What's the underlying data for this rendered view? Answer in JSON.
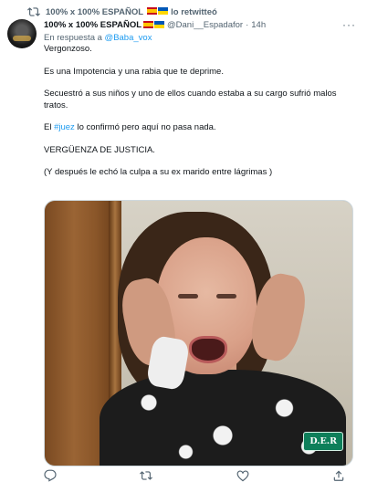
{
  "retweet_bar": {
    "retweeter_name": "100% x 100% ESPAÑOL",
    "retweet_label": "lo retwitteó"
  },
  "tweet": {
    "author_name": "100% x 100% ESPAÑOL",
    "handle": "@Dani__Espadafor",
    "separator": "·",
    "timestamp": "14h",
    "reply_prefix": "En respuesta a",
    "reply_handle": "@Baba_vox",
    "text": {
      "p1": "Vergonzoso.",
      "p2": "Es una Impotencia y una rabia que te deprime.",
      "p3": "Secuestró a sus niños y uno de ellos cuando estaba a su cargo sufrió malos tratos.",
      "p4_before": "El",
      "p4_hashtag": "#juez",
      "p4_after": "lo confirmó pero aquí no pasa nada.",
      "p5": "VERGÜENZA DE JUSTICIA.",
      "p6": "(Y después le echó la culpa a su ex marido entre lágrimas )"
    },
    "media": {
      "watermark": "D.E.R"
    }
  },
  "icons": {
    "retweet": "retweet-icon",
    "more": "more-icon",
    "reply": "reply-icon",
    "like": "heart-icon",
    "share": "share-icon",
    "flag_spain": "spain-flag-icon",
    "flag_ukraine": "ukraine-flag-icon"
  },
  "colors": {
    "link": "#1d9bf0",
    "secondary_text": "#536471",
    "primary_text": "#0f1419",
    "watermark_bg": "#0e7f5a"
  }
}
